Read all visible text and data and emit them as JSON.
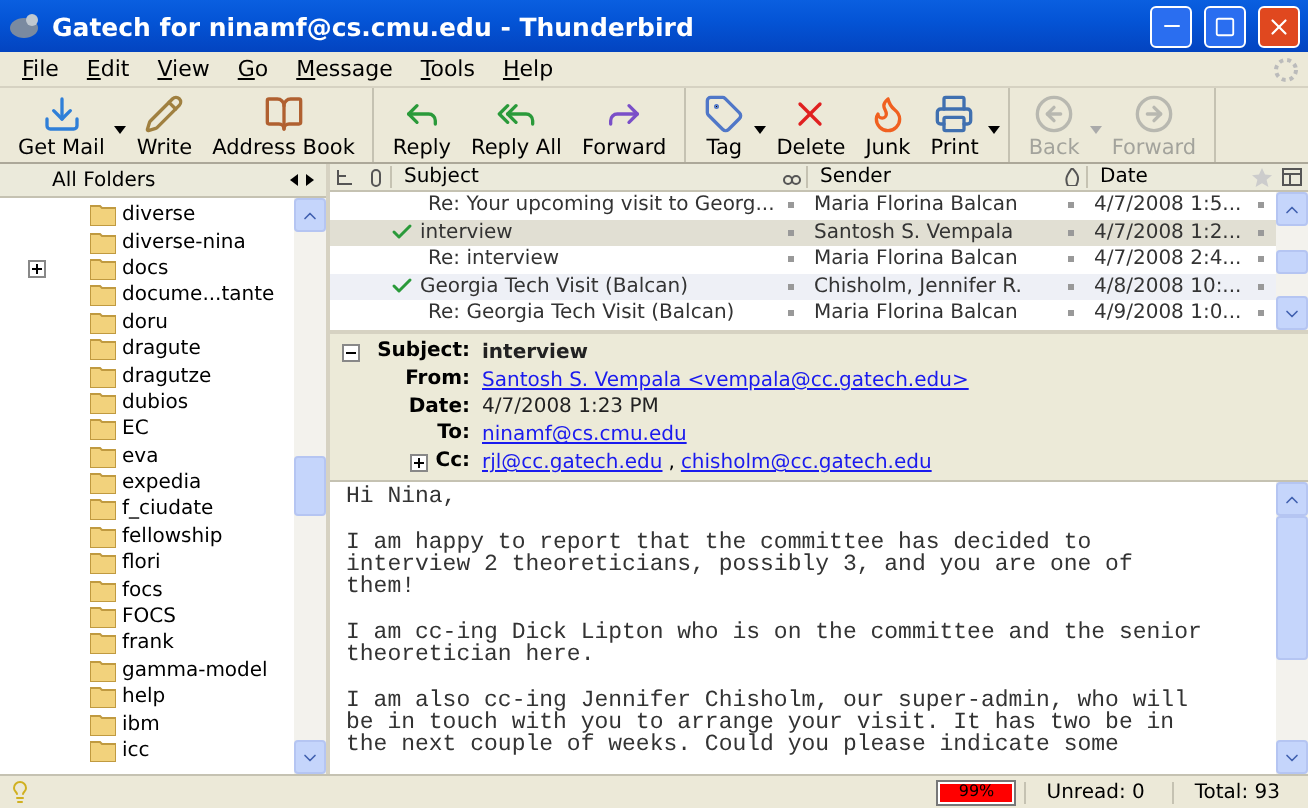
{
  "window": {
    "title": "Gatech for ninamf@cs.cmu.edu - Thunderbird"
  },
  "menu": [
    "File",
    "Edit",
    "View",
    "Go",
    "Message",
    "Tools",
    "Help"
  ],
  "toolbar": [
    [
      {
        "kind": "getmail",
        "label": "Get Mail",
        "dropdown": true,
        "disabled": false
      },
      {
        "kind": "write",
        "label": "Write",
        "dropdown": false,
        "disabled": false
      },
      {
        "kind": "addressbook",
        "label": "Address Book",
        "dropdown": false,
        "disabled": false
      }
    ],
    [
      {
        "kind": "reply",
        "label": "Reply",
        "dropdown": false,
        "disabled": false
      },
      {
        "kind": "replyall",
        "label": "Reply All",
        "dropdown": false,
        "disabled": false
      },
      {
        "kind": "forward",
        "label": "Forward",
        "dropdown": false,
        "disabled": false
      }
    ],
    [
      {
        "kind": "tag",
        "label": "Tag",
        "dropdown": true,
        "disabled": false
      },
      {
        "kind": "delete",
        "label": "Delete",
        "dropdown": false,
        "disabled": false
      },
      {
        "kind": "junk",
        "label": "Junk",
        "dropdown": false,
        "disabled": false
      },
      {
        "kind": "print",
        "label": "Print",
        "dropdown": true,
        "disabled": false
      }
    ],
    [
      {
        "kind": "back",
        "label": "Back",
        "dropdown": true,
        "disabled": true
      },
      {
        "kind": "next",
        "label": "Forward",
        "dropdown": false,
        "disabled": true
      }
    ]
  ],
  "folder_pane": {
    "header": "All Folders",
    "folders": [
      {
        "name": "diverse",
        "expandable": false
      },
      {
        "name": "diverse-nina",
        "expandable": false
      },
      {
        "name": "docs",
        "expandable": true
      },
      {
        "name": "docume...tante",
        "expandable": false
      },
      {
        "name": "doru",
        "expandable": false
      },
      {
        "name": "dragute",
        "expandable": false
      },
      {
        "name": "dragutze",
        "expandable": false
      },
      {
        "name": "dubios",
        "expandable": false
      },
      {
        "name": "EC",
        "expandable": false
      },
      {
        "name": "eva",
        "expandable": false
      },
      {
        "name": "expedia",
        "expandable": false
      },
      {
        "name": "f_ciudate",
        "expandable": false
      },
      {
        "name": "fellowship",
        "expandable": false
      },
      {
        "name": "flori",
        "expandable": false
      },
      {
        "name": "focs",
        "expandable": false
      },
      {
        "name": "FOCS",
        "expandable": false
      },
      {
        "name": "frank",
        "expandable": false
      },
      {
        "name": "gamma-model",
        "expandable": false
      },
      {
        "name": "help",
        "expandable": false
      },
      {
        "name": "ibm",
        "expandable": false
      },
      {
        "name": "icc",
        "expandable": false
      }
    ]
  },
  "thread_list": {
    "columns": {
      "subject": "Subject",
      "sender": "Sender",
      "date": "Date"
    },
    "rows": [
      {
        "subject": "Re: Your upcoming visit to Georg...",
        "sender": "Maria Florina Balcan",
        "date": "4/7/2008 1:5...",
        "replied": false,
        "selected": false
      },
      {
        "subject": "interview",
        "sender": "Santosh S. Vempala",
        "date": "4/7/2008 1:2...",
        "replied": true,
        "selected": true
      },
      {
        "subject": "Re: interview",
        "sender": "Maria Florina Balcan",
        "date": "4/7/2008 2:4...",
        "replied": false,
        "selected": false
      },
      {
        "subject": "Georgia Tech Visit (Balcan)",
        "sender": "Chisholm, Jennifer R.",
        "date": "4/8/2008 10:...",
        "replied": true,
        "selected": false
      },
      {
        "subject": "Re: Georgia Tech Visit (Balcan)",
        "sender": "Maria Florina Balcan",
        "date": "4/9/2008 1:0...",
        "replied": false,
        "selected": false
      }
    ]
  },
  "message_header": {
    "expanded": true,
    "fields": [
      {
        "label": "Subject:",
        "kind": "bold",
        "values": [
          "interview"
        ]
      },
      {
        "label": "From:",
        "kind": "link",
        "values": [
          "Santosh S. Vempala <vempala@cc.gatech.edu>"
        ]
      },
      {
        "label": "Date:",
        "kind": "text",
        "values": [
          "4/7/2008 1:23 PM"
        ]
      },
      {
        "label": "To:",
        "kind": "link",
        "values": [
          "ninamf@cs.cmu.edu"
        ]
      },
      {
        "label": "Cc:",
        "kind": "link",
        "collapsed": true,
        "separator": ",",
        "values": [
          "rjl@cc.gatech.edu",
          "chisholm@cc.gatech.edu"
        ]
      }
    ]
  },
  "message_body": [
    "Hi Nina,",
    "I am happy to report that the committee has decided to interview 2 theoreticians, possibly 3, and you are one of them!",
    "I am cc-ing Dick Lipton who is on the committee and the senior theoretician here.",
    "I am also cc-ing Jennifer Chisholm, our super-admin, who will be in touch with you to arrange your visit. It has two be in the next couple of weeks. Could you please indicate some"
  ],
  "status_bar": {
    "progress": {
      "level": 0.99,
      "reading": "99%"
    },
    "unread": "Unread: 0",
    "total": "Total: 93"
  }
}
